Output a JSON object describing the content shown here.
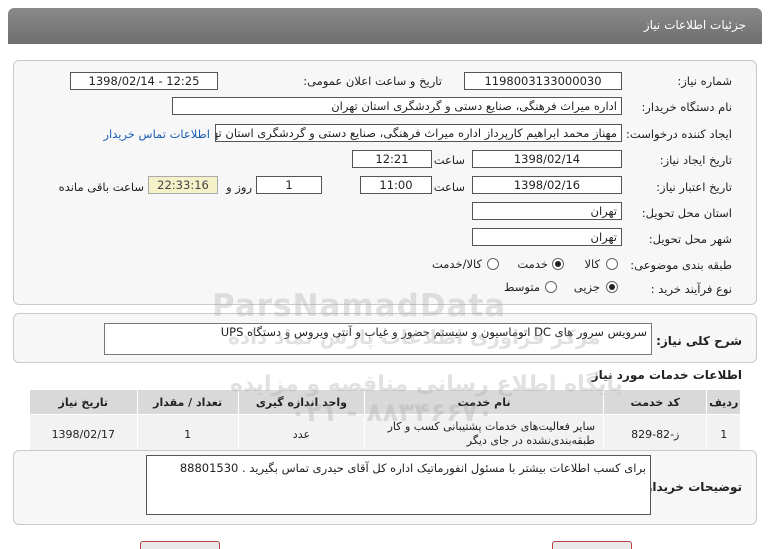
{
  "page": {
    "title": "جزئیات اطلاعات نیاز"
  },
  "form": {
    "need_number_label": "شماره نیاز:",
    "need_number": "1198003133000030",
    "announce_label": "تاریخ و ساعت اعلان عمومی:",
    "announce_value": "1398/02/14 - 12:25",
    "buyer_org_label": "نام دستگاه خریدار:",
    "buyer_org": "اداره میراث فرهنگی، صنایع دستی و گردشگری استان تهران",
    "requester_label": "ایجاد کننده درخواست:",
    "requester": "مهناز محمد ابراهیم کارپرداز اداره میراث فرهنگی، صنایع دستی و گردشگری استان تهران",
    "contact_link": "اطلاعات تماس خریدار",
    "created_label": "تاریخ ایجاد نیاز:",
    "created_date": "1398/02/14",
    "time_label": "ساعت",
    "created_time": "12:21",
    "validity_label": "تاریخ اعتبار نیاز:",
    "validity_date": "1398/02/16",
    "validity_time": "11:00",
    "days_value": "1",
    "days_label": "روز و",
    "remaining_time": "22:33:16",
    "remaining_label": "ساعت باقی مانده",
    "province_label": "استان محل تحویل:",
    "province": "تهران",
    "city_label": "شهر محل تحویل:",
    "city": "تهران",
    "category_label": "طبقه بندی موضوعی:",
    "category_options": [
      "کالا",
      "خدمت",
      "کالا/خدمت"
    ],
    "category_selected": "خدمت",
    "process_label": "نوع فرآیند خرید :",
    "process_options": [
      "جزیی",
      "متوسط"
    ],
    "process_selected": "جزیی"
  },
  "summary": {
    "label": "شرح کلی نیاز:",
    "text": "سرویس سرور های DC اتوماسیون و سیستم حضور و غیاب و آنتی ویروس و دستگاه UPS"
  },
  "services": {
    "title": "اطلاعات خدمات مورد نیاز",
    "headers": [
      "ردیف",
      "کد خدمت",
      "نام خدمت",
      "واحد اندازه گیری",
      "تعداد / مقدار",
      "تاریخ نیاز"
    ],
    "rows": [
      {
        "index": "1",
        "code": "ز-82-829",
        "name": "سایر فعالیت‌های خدمات پشتیبانی کسب و کار طبقه‌بندی‌نشده در جای دیگر",
        "unit": "عدد",
        "qty": "1",
        "date": "1398/02/17"
      }
    ]
  },
  "notes": {
    "label": "توضیحات خریدار:",
    "text": "برای کسب اطلاعات بیشتر با مسئول انفورماتیک اداره کل آقای حیدری تماس بگیرید . 88801530"
  },
  "watermark": {
    "brand": "ParsNamadData",
    "line1": "مرکز فراوری اطلاعات پارس نماد داده",
    "line2": "پایگاه اطلاع رسانی مناقصه و مزایده",
    "phone": "۰۲۱ - ۸۸۳۴۶۶۷۰"
  },
  "colors": {
    "titlebar": "#7a7a7a",
    "link": "#1a5fb4",
    "remaining_bg": "#f4f1c9"
  }
}
